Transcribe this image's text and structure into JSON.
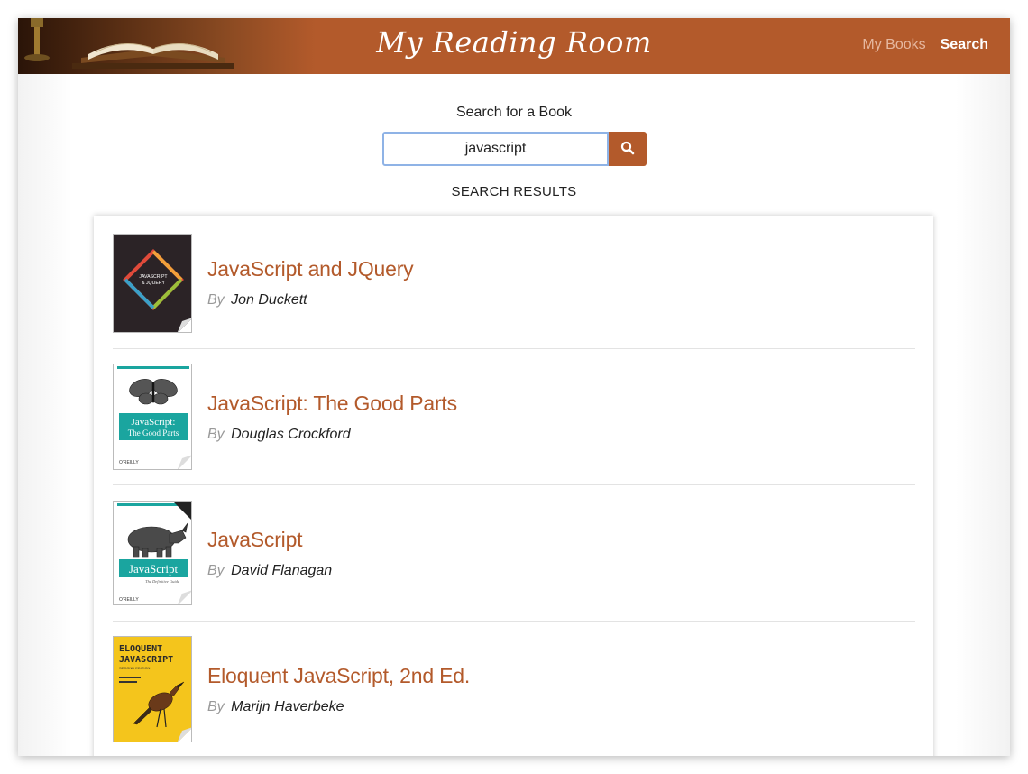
{
  "header": {
    "brand": "My Reading Room",
    "nav": [
      {
        "label": "My Books",
        "active": false
      },
      {
        "label": "Search",
        "active": true
      }
    ]
  },
  "search": {
    "title": "Search for a Book",
    "query": "javascript",
    "button_icon": "search-icon",
    "results_heading": "SEARCH RESULTS"
  },
  "results": [
    {
      "title": "JavaScript and JQuery",
      "by": "By",
      "author": "Jon Duckett",
      "cover": {
        "icon": "book-cover-image",
        "text": "JAVASCRIPT & JQUERY",
        "background": "#2b2326"
      }
    },
    {
      "title": "JavaScript: The Good Parts",
      "by": "By",
      "author": "Douglas Crockford",
      "cover": {
        "icon": "book-cover-image",
        "text": "JavaScript: The Good Parts",
        "publisher": "O'REILLY",
        "background": "#ffffff",
        "band": "#1aa59f"
      }
    },
    {
      "title": "JavaScript",
      "by": "By",
      "author": "David Flanagan",
      "cover": {
        "icon": "book-cover-image",
        "text": "JavaScript",
        "subtitle": "The Definitive Guide",
        "publisher": "O'REILLY",
        "background": "#ffffff",
        "band": "#1aa59f"
      }
    },
    {
      "title": "Eloquent JavaScript, 2nd Ed.",
      "by": "By",
      "author": "Marijn Haverbeke",
      "cover": {
        "icon": "book-cover-image",
        "text": "ELOQUENT JAVASCRIPT",
        "edition": "SECOND EDITION",
        "background": "#f4c51c"
      }
    }
  ],
  "colors": {
    "brand": "#b35a2b",
    "nav_inactive": "#e6b8a0",
    "input_border": "#8fb3e6",
    "muted": "#999999"
  }
}
